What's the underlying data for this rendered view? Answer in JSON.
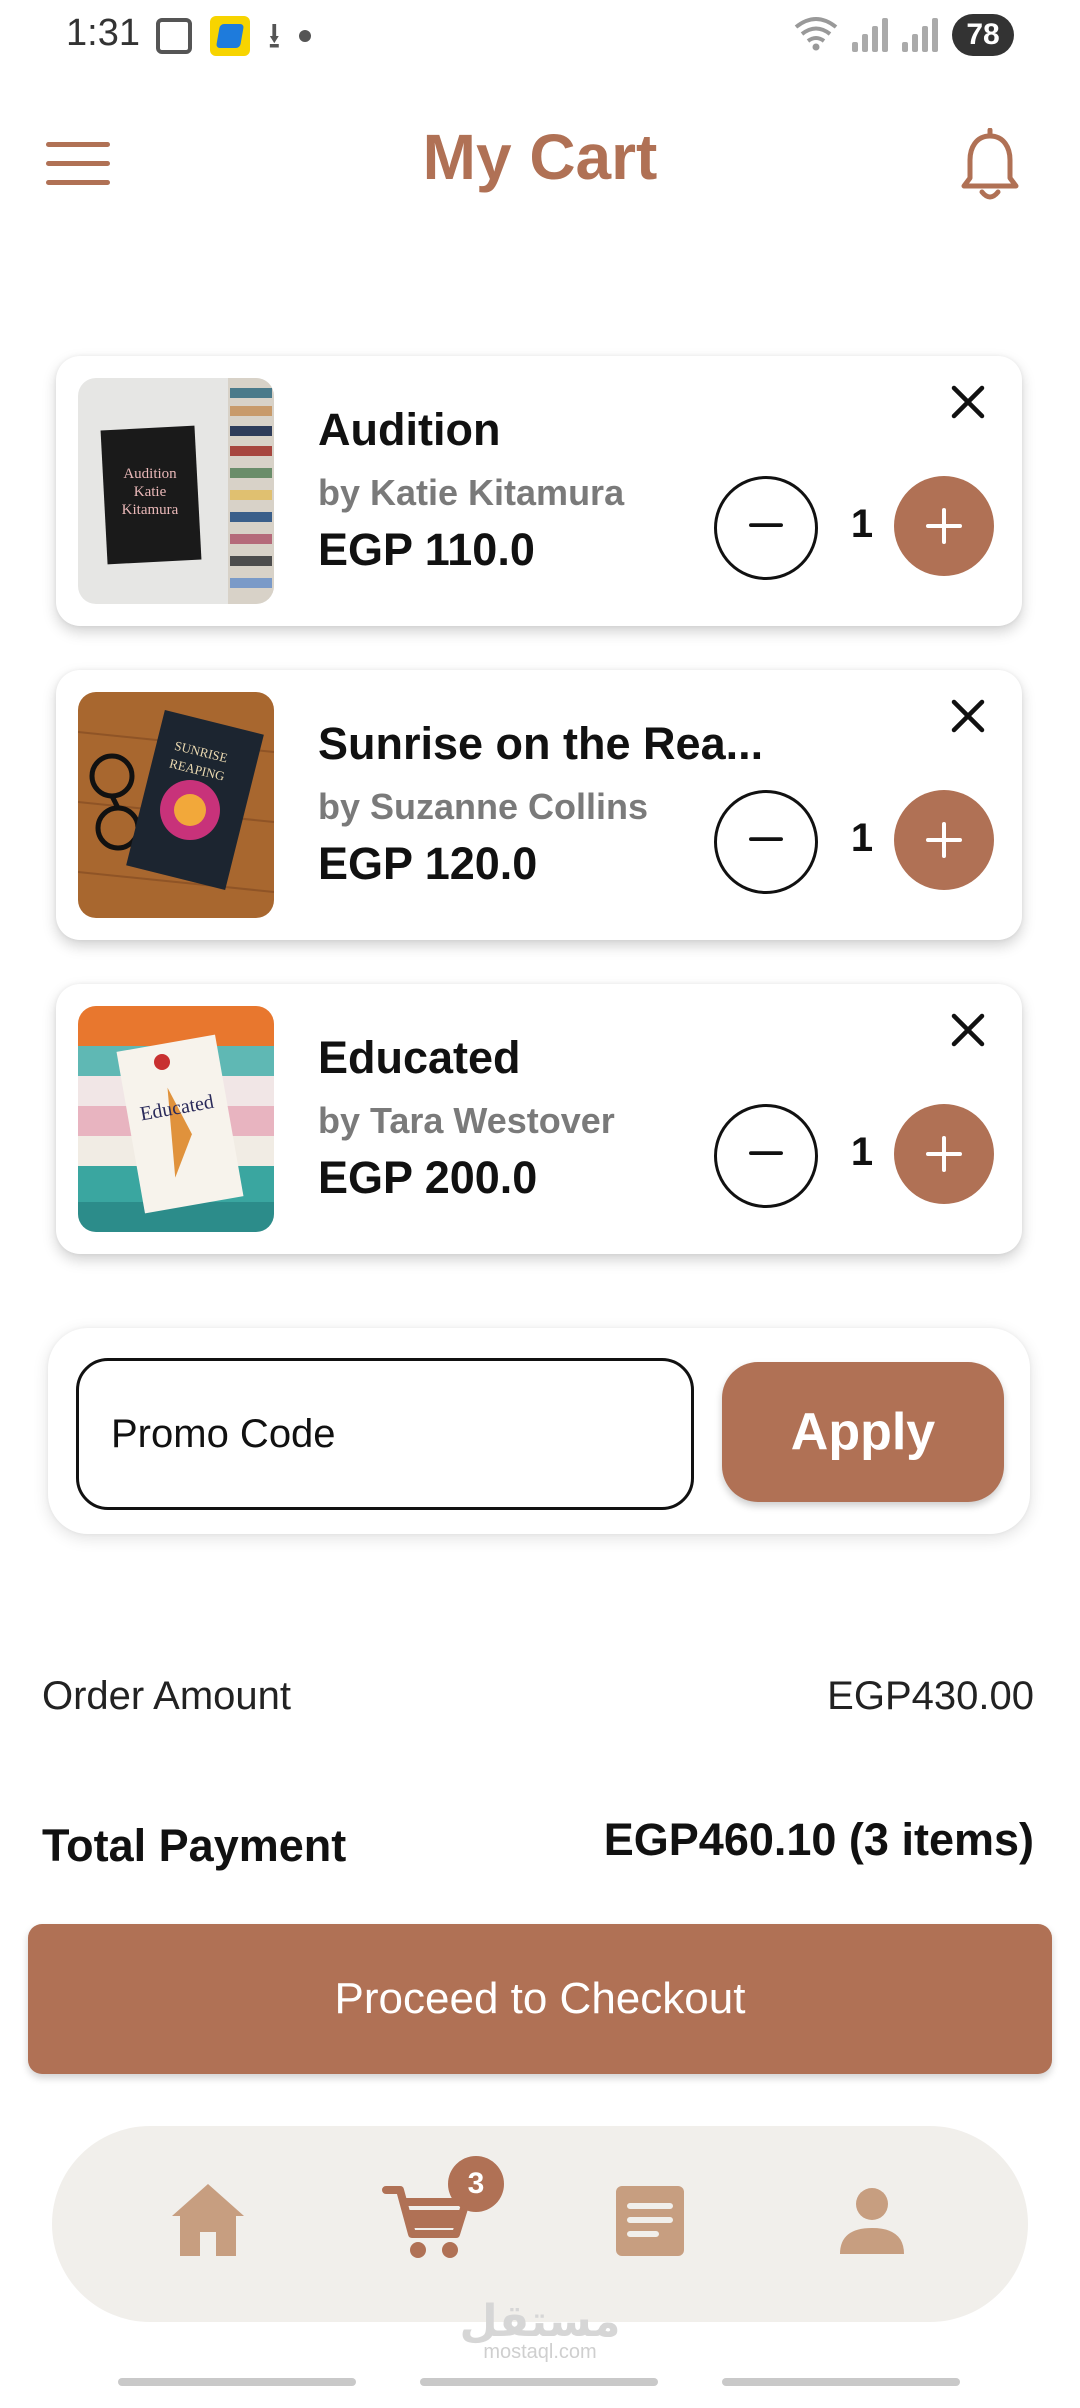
{
  "status_bar": {
    "time": "1:31",
    "battery": "78"
  },
  "header": {
    "title": "My Cart",
    "menu_icon": "hamburger-menu-icon",
    "notification_icon": "bell-icon"
  },
  "cart": {
    "items": [
      {
        "title": "Audition",
        "author": "by Katie Kitamura",
        "price": "EGP 110.0",
        "quantity": "1",
        "cover_text": "Audition Katie Kitamura"
      },
      {
        "title": "Sunrise on the Rea...",
        "author": "by Suzanne Collins",
        "price": "EGP 120.0",
        "quantity": "1",
        "cover_text": "SUNRISE ON THE REAPING"
      },
      {
        "title": "Educated",
        "author": "by Tara Westover",
        "price": "EGP 200.0",
        "quantity": "1",
        "cover_text": "Educated"
      }
    ]
  },
  "promo": {
    "placeholder": "Promo Code",
    "value": "",
    "apply_label": "Apply"
  },
  "summary": {
    "order_amount_label": "Order Amount",
    "order_amount_value": "EGP430.00",
    "total_label": "Total Payment",
    "total_value": "EGP460.10 (3 items)"
  },
  "checkout": {
    "label": "Proceed to Checkout"
  },
  "bottom_nav": {
    "items": [
      "home",
      "cart",
      "orders",
      "profile"
    ],
    "cart_badge": "3"
  },
  "watermark": {
    "arabic": "مستقل",
    "latin": "mostaql.com"
  },
  "colors": {
    "accent": "#b07155",
    "nav_background": "#f1efeb",
    "nav_icon": "#c79e80"
  }
}
